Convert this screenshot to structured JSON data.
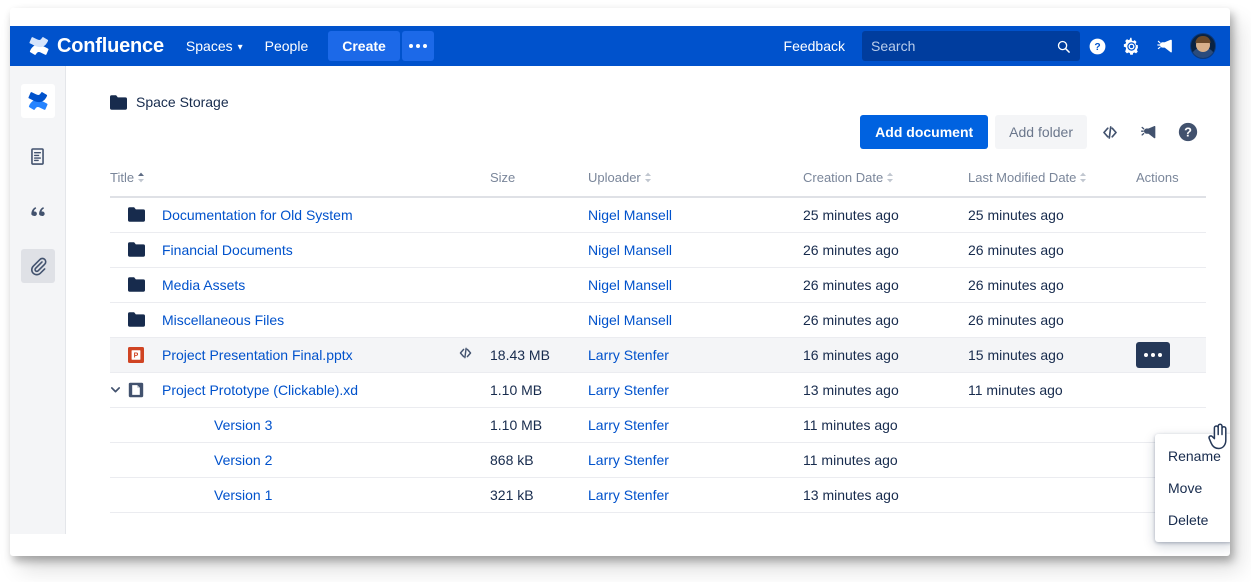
{
  "topnav": {
    "brand": "Confluence",
    "brand_logo_icon": "confluence-logo-icon",
    "items": [
      {
        "label": "Spaces",
        "has_caret": true
      },
      {
        "label": "People",
        "has_caret": false
      }
    ],
    "create_label": "Create",
    "create_more_icon": "ellipsis-icon",
    "feedback_label": "Feedback",
    "search_placeholder": "Search",
    "search_value": "",
    "search_icon": "search-icon",
    "help_icon": "help-circle-icon",
    "settings_icon": "gear-icon",
    "notifications_icon": "megaphone-icon",
    "avatar_icon": "user-avatar",
    "bg_color": "#0052cc",
    "search_bg_color": "#003d9e"
  },
  "rail": {
    "items": [
      {
        "icon": "confluence-logo-icon",
        "active": false,
        "white": true
      },
      {
        "icon": "page-icon",
        "active": false,
        "white": false
      },
      {
        "icon": "quote-icon",
        "active": false,
        "white": false
      },
      {
        "icon": "paperclip-icon",
        "active": true,
        "white": false
      }
    ]
  },
  "breadcrumb": {
    "folder_icon": "folder-icon",
    "label": "Space Storage"
  },
  "toolbar": {
    "add_document_label": "Add document",
    "add_folder_label": "Add folder",
    "embed_icon": "code-embed-icon",
    "announce_icon": "megaphone-icon",
    "help_icon": "help-circle-icon",
    "primary_color": "#0062e0"
  },
  "table": {
    "columns": [
      {
        "label": "Title",
        "sort": "asc"
      },
      {
        "label": "",
        "sort": "none"
      },
      {
        "label": "Size",
        "sort": "none"
      },
      {
        "label": "Uploader",
        "sort": "both"
      },
      {
        "label": "Creation Date",
        "sort": "both"
      },
      {
        "label": "Last Modified Date",
        "sort": "both"
      },
      {
        "label": "Actions",
        "sort": "none"
      }
    ],
    "rows": [
      {
        "icon": "folder-icon",
        "chevron": "",
        "indent": false,
        "title": "Documentation for Old System",
        "embed": false,
        "size": "",
        "uploader": "Nigel Mansell",
        "created": "25 minutes ago",
        "modified": "25 minutes ago",
        "actions": false,
        "highlight": false
      },
      {
        "icon": "folder-icon",
        "chevron": "",
        "indent": false,
        "title": "Financial Documents",
        "embed": false,
        "size": "",
        "uploader": "Nigel Mansell",
        "created": "26 minutes ago",
        "modified": "26 minutes ago",
        "actions": false,
        "highlight": false
      },
      {
        "icon": "folder-icon",
        "chevron": "",
        "indent": false,
        "title": "Media Assets",
        "embed": false,
        "size": "",
        "uploader": "Nigel Mansell",
        "created": "26 minutes ago",
        "modified": "26 minutes ago",
        "actions": false,
        "highlight": false
      },
      {
        "icon": "folder-icon",
        "chevron": "",
        "indent": false,
        "title": "Miscellaneous Files",
        "embed": false,
        "size": "",
        "uploader": "Nigel Mansell",
        "created": "26 minutes ago",
        "modified": "26 minutes ago",
        "actions": false,
        "highlight": false
      },
      {
        "icon": "powerpoint-file-icon",
        "chevron": "",
        "indent": false,
        "title": "Project Presentation Final.pptx",
        "embed": true,
        "size": "18.43 MB",
        "uploader": "Larry Stenfer",
        "created": "16 minutes ago",
        "modified": "15 minutes ago",
        "actions": true,
        "highlight": true
      },
      {
        "icon": "xd-file-icon",
        "chevron": "expanded",
        "indent": false,
        "title": "Project Prototype (Clickable).xd",
        "embed": false,
        "size": "1.10 MB",
        "uploader": "Larry Stenfer",
        "created": "13 minutes ago",
        "modified": "11 minutes ago",
        "actions": false,
        "highlight": false
      },
      {
        "icon": "",
        "chevron": "",
        "indent": true,
        "title": "Version 3",
        "embed": false,
        "size": "1.10 MB",
        "uploader": "Larry Stenfer",
        "created": "11 minutes ago",
        "modified": "",
        "actions": false,
        "highlight": false
      },
      {
        "icon": "",
        "chevron": "",
        "indent": true,
        "title": "Version 2",
        "embed": false,
        "size": "868 kB",
        "uploader": "Larry Stenfer",
        "created": "11 minutes ago",
        "modified": "",
        "actions": false,
        "highlight": false
      },
      {
        "icon": "",
        "chevron": "",
        "indent": true,
        "title": "Version 1",
        "embed": false,
        "size": "321 kB",
        "uploader": "Larry Stenfer",
        "created": "13 minutes ago",
        "modified": "",
        "actions": false,
        "highlight": false
      }
    ]
  },
  "dropdown": {
    "open": true,
    "items": [
      "Rename",
      "Move",
      "Delete"
    ]
  },
  "cursor": {
    "icon": "hand-pointer-cursor"
  },
  "colors": {
    "link": "#0052cc",
    "text": "#172b4d",
    "muted": "#7a869a",
    "row_highlight": "#f4f5f7",
    "dots_button": "#253858"
  }
}
